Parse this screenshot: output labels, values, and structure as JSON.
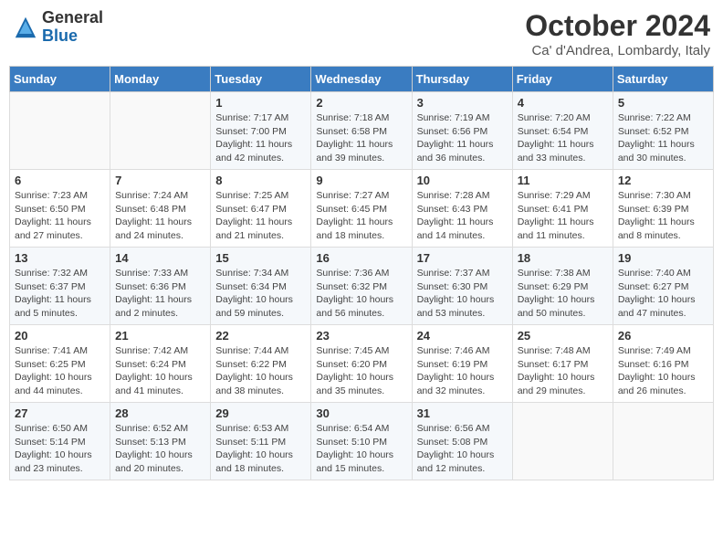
{
  "header": {
    "logo_general": "General",
    "logo_blue": "Blue",
    "month_title": "October 2024",
    "location": "Ca' d'Andrea, Lombardy, Italy"
  },
  "weekdays": [
    "Sunday",
    "Monday",
    "Tuesday",
    "Wednesday",
    "Thursday",
    "Friday",
    "Saturday"
  ],
  "weeks": [
    [
      {
        "day": "",
        "info": ""
      },
      {
        "day": "",
        "info": ""
      },
      {
        "day": "1",
        "info": "Sunrise: 7:17 AM\nSunset: 7:00 PM\nDaylight: 11 hours and 42 minutes."
      },
      {
        "day": "2",
        "info": "Sunrise: 7:18 AM\nSunset: 6:58 PM\nDaylight: 11 hours and 39 minutes."
      },
      {
        "day": "3",
        "info": "Sunrise: 7:19 AM\nSunset: 6:56 PM\nDaylight: 11 hours and 36 minutes."
      },
      {
        "day": "4",
        "info": "Sunrise: 7:20 AM\nSunset: 6:54 PM\nDaylight: 11 hours and 33 minutes."
      },
      {
        "day": "5",
        "info": "Sunrise: 7:22 AM\nSunset: 6:52 PM\nDaylight: 11 hours and 30 minutes."
      }
    ],
    [
      {
        "day": "6",
        "info": "Sunrise: 7:23 AM\nSunset: 6:50 PM\nDaylight: 11 hours and 27 minutes."
      },
      {
        "day": "7",
        "info": "Sunrise: 7:24 AM\nSunset: 6:48 PM\nDaylight: 11 hours and 24 minutes."
      },
      {
        "day": "8",
        "info": "Sunrise: 7:25 AM\nSunset: 6:47 PM\nDaylight: 11 hours and 21 minutes."
      },
      {
        "day": "9",
        "info": "Sunrise: 7:27 AM\nSunset: 6:45 PM\nDaylight: 11 hours and 18 minutes."
      },
      {
        "day": "10",
        "info": "Sunrise: 7:28 AM\nSunset: 6:43 PM\nDaylight: 11 hours and 14 minutes."
      },
      {
        "day": "11",
        "info": "Sunrise: 7:29 AM\nSunset: 6:41 PM\nDaylight: 11 hours and 11 minutes."
      },
      {
        "day": "12",
        "info": "Sunrise: 7:30 AM\nSunset: 6:39 PM\nDaylight: 11 hours and 8 minutes."
      }
    ],
    [
      {
        "day": "13",
        "info": "Sunrise: 7:32 AM\nSunset: 6:37 PM\nDaylight: 11 hours and 5 minutes."
      },
      {
        "day": "14",
        "info": "Sunrise: 7:33 AM\nSunset: 6:36 PM\nDaylight: 11 hours and 2 minutes."
      },
      {
        "day": "15",
        "info": "Sunrise: 7:34 AM\nSunset: 6:34 PM\nDaylight: 10 hours and 59 minutes."
      },
      {
        "day": "16",
        "info": "Sunrise: 7:36 AM\nSunset: 6:32 PM\nDaylight: 10 hours and 56 minutes."
      },
      {
        "day": "17",
        "info": "Sunrise: 7:37 AM\nSunset: 6:30 PM\nDaylight: 10 hours and 53 minutes."
      },
      {
        "day": "18",
        "info": "Sunrise: 7:38 AM\nSunset: 6:29 PM\nDaylight: 10 hours and 50 minutes."
      },
      {
        "day": "19",
        "info": "Sunrise: 7:40 AM\nSunset: 6:27 PM\nDaylight: 10 hours and 47 minutes."
      }
    ],
    [
      {
        "day": "20",
        "info": "Sunrise: 7:41 AM\nSunset: 6:25 PM\nDaylight: 10 hours and 44 minutes."
      },
      {
        "day": "21",
        "info": "Sunrise: 7:42 AM\nSunset: 6:24 PM\nDaylight: 10 hours and 41 minutes."
      },
      {
        "day": "22",
        "info": "Sunrise: 7:44 AM\nSunset: 6:22 PM\nDaylight: 10 hours and 38 minutes."
      },
      {
        "day": "23",
        "info": "Sunrise: 7:45 AM\nSunset: 6:20 PM\nDaylight: 10 hours and 35 minutes."
      },
      {
        "day": "24",
        "info": "Sunrise: 7:46 AM\nSunset: 6:19 PM\nDaylight: 10 hours and 32 minutes."
      },
      {
        "day": "25",
        "info": "Sunrise: 7:48 AM\nSunset: 6:17 PM\nDaylight: 10 hours and 29 minutes."
      },
      {
        "day": "26",
        "info": "Sunrise: 7:49 AM\nSunset: 6:16 PM\nDaylight: 10 hours and 26 minutes."
      }
    ],
    [
      {
        "day": "27",
        "info": "Sunrise: 6:50 AM\nSunset: 5:14 PM\nDaylight: 10 hours and 23 minutes."
      },
      {
        "day": "28",
        "info": "Sunrise: 6:52 AM\nSunset: 5:13 PM\nDaylight: 10 hours and 20 minutes."
      },
      {
        "day": "29",
        "info": "Sunrise: 6:53 AM\nSunset: 5:11 PM\nDaylight: 10 hours and 18 minutes."
      },
      {
        "day": "30",
        "info": "Sunrise: 6:54 AM\nSunset: 5:10 PM\nDaylight: 10 hours and 15 minutes."
      },
      {
        "day": "31",
        "info": "Sunrise: 6:56 AM\nSunset: 5:08 PM\nDaylight: 10 hours and 12 minutes."
      },
      {
        "day": "",
        "info": ""
      },
      {
        "day": "",
        "info": ""
      }
    ]
  ]
}
